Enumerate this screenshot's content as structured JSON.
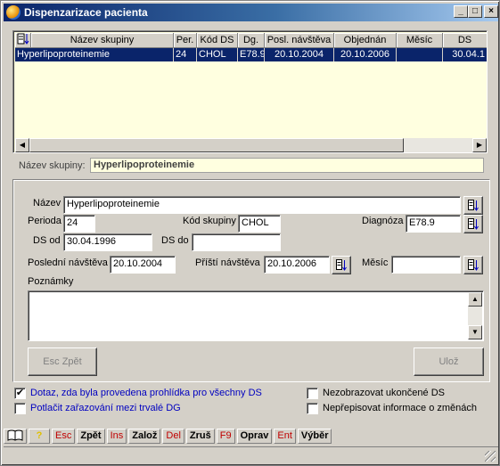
{
  "window": {
    "title": "Dispenzarizace pacienta"
  },
  "grid": {
    "columns": [
      "Název skupiny",
      "Per.",
      "Kód DS",
      "Dg.",
      "Posl. návštěva",
      "Objednán",
      "Měsíc",
      "DS"
    ],
    "rows": [
      [
        "Hyperlipoproteinemie",
        "24",
        "CHOL",
        "E78.9",
        "20.10.2004",
        "20.10.2006",
        "",
        "30.04.1"
      ]
    ]
  },
  "group_name": {
    "label": "Název skupiny:",
    "value": "Hyperlipoproteinemie"
  },
  "form": {
    "nazev_label": "Název",
    "nazev_value": "Hyperlipoproteinemie",
    "perioda_label": "Perioda",
    "perioda_value": "24",
    "kod_skupiny_label": "Kód skupiny",
    "kod_skupiny_value": "CHOL",
    "diagnoza_label": "Diagnóza",
    "diagnoza_value": "E78.9",
    "ds_od_label": "DS od",
    "ds_od_value": "30.04.1996",
    "ds_do_label": "DS do",
    "ds_do_value": "",
    "posledni_label": "Poslední návštěva",
    "posledni_value": "20.10.2004",
    "pristi_label": "Příští návštěva",
    "pristi_value": "20.10.2006",
    "mesic_label": "Měsíc",
    "mesic_value": "",
    "poznamky_label": "Poznámky"
  },
  "buttons": {
    "esc": "Esc Zpět",
    "uloz": "Ulož"
  },
  "options": {
    "dotaz": {
      "label": "Dotaz, zda byla provedena prohlídka pro všechny DS",
      "checked": true
    },
    "potlacit": {
      "label": "Potlačit zařazování mezi trvalé DG",
      "checked": false
    },
    "nezobrazovat": {
      "label": "Nezobrazovat ukončené DS",
      "checked": false
    },
    "neprepisovat": {
      "label": "Nepřepisovat informace o změnách",
      "checked": false
    }
  },
  "statusbar": {
    "help_icon": "?",
    "items": [
      {
        "key": "Esc",
        "action": "Zpět"
      },
      {
        "key": "Ins",
        "action": "Založ"
      },
      {
        "key": "Del",
        "action": "Zruš"
      },
      {
        "key": "F9",
        "action": "Oprav"
      },
      {
        "key": "Ent",
        "action": "Výběr"
      }
    ]
  },
  "colors": {
    "selection": "#0a246a",
    "grid_bg": "#ffffe0",
    "link_text": "#0000c0",
    "key_text": "#c00000"
  }
}
